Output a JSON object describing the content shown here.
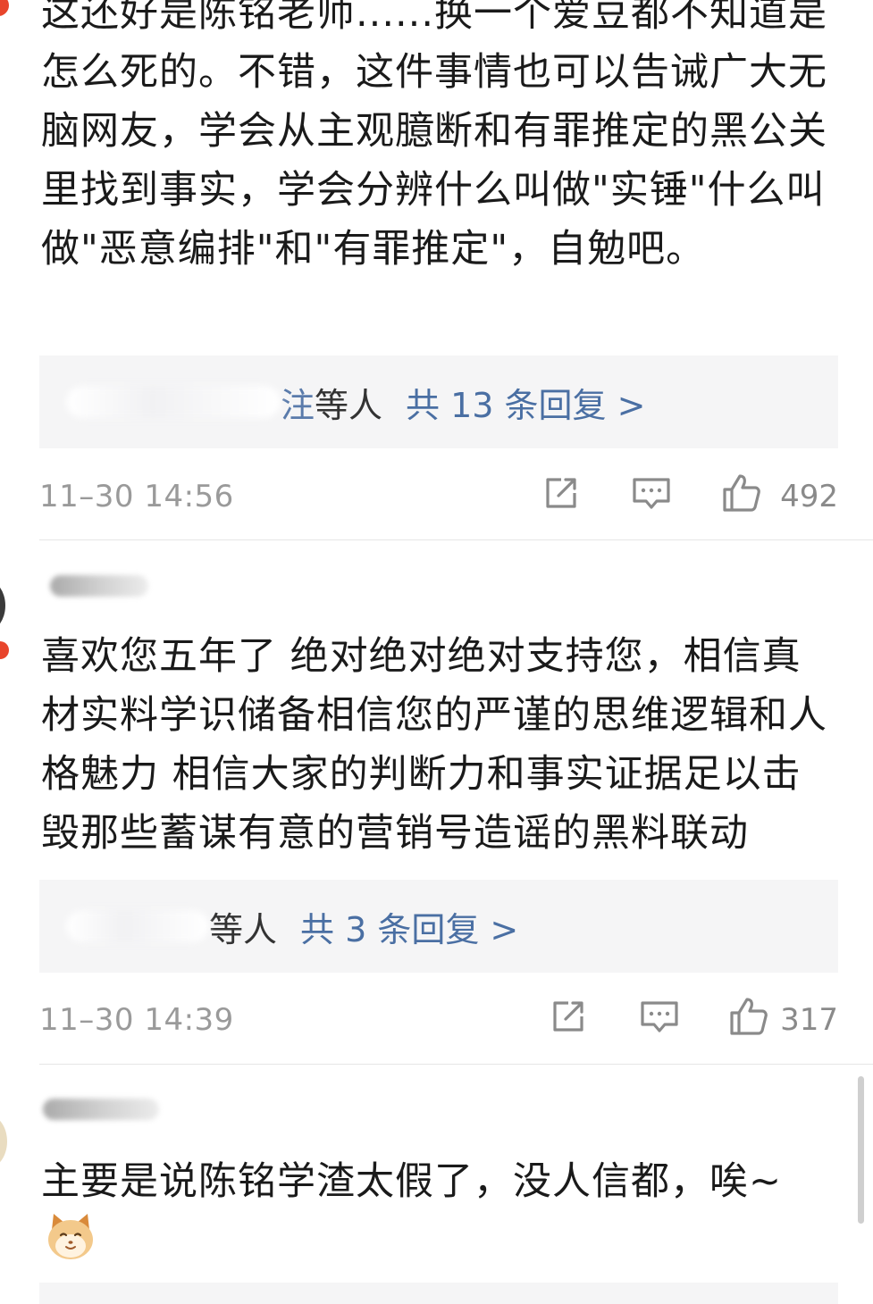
{
  "comments": [
    {
      "text": "这还好是陈铭老师......换一个爱豆都不知道是怎么死的。不错，这件事情也可以告诫广大无脑网友，学会从主观臆断和有罪推定的黑公关里找到事实，学会分辨什么叫做\"实锤\"什么叫做\"恶意编排\"和\"有罪推定\"，自勉吧。",
      "reply_partial": "注",
      "reply_who": "等人",
      "reply_count": "共 13 条回复 >",
      "time": "11–30 14:56",
      "likes": "492"
    },
    {
      "text": "喜欢您五年了 绝对绝对绝对支持您，相信真材实料学识储备相信您的严谨的思维逻辑和人格魅力 相信大家的判断力和事实证据足以击毁那些蓄谋有意的营销号造谣的黑料联动",
      "reply_partial": "",
      "reply_who": "等人",
      "reply_count": "共 3 条回复 >",
      "time": "11–30 14:39",
      "likes": "317"
    },
    {
      "text": "主要是说陈铭学渣太假了，没人信都，唉~"
    }
  ],
  "icons": {
    "share": "share-icon",
    "comment": "comment-icon",
    "like": "thumbs-up-icon",
    "emoji": "cat-emoji-icon"
  },
  "colors": {
    "link": "#4a6fa3",
    "meta": "#9a9a9a",
    "reply_bg": "#f5f5f6",
    "avatar_badge": "#e8452c"
  }
}
